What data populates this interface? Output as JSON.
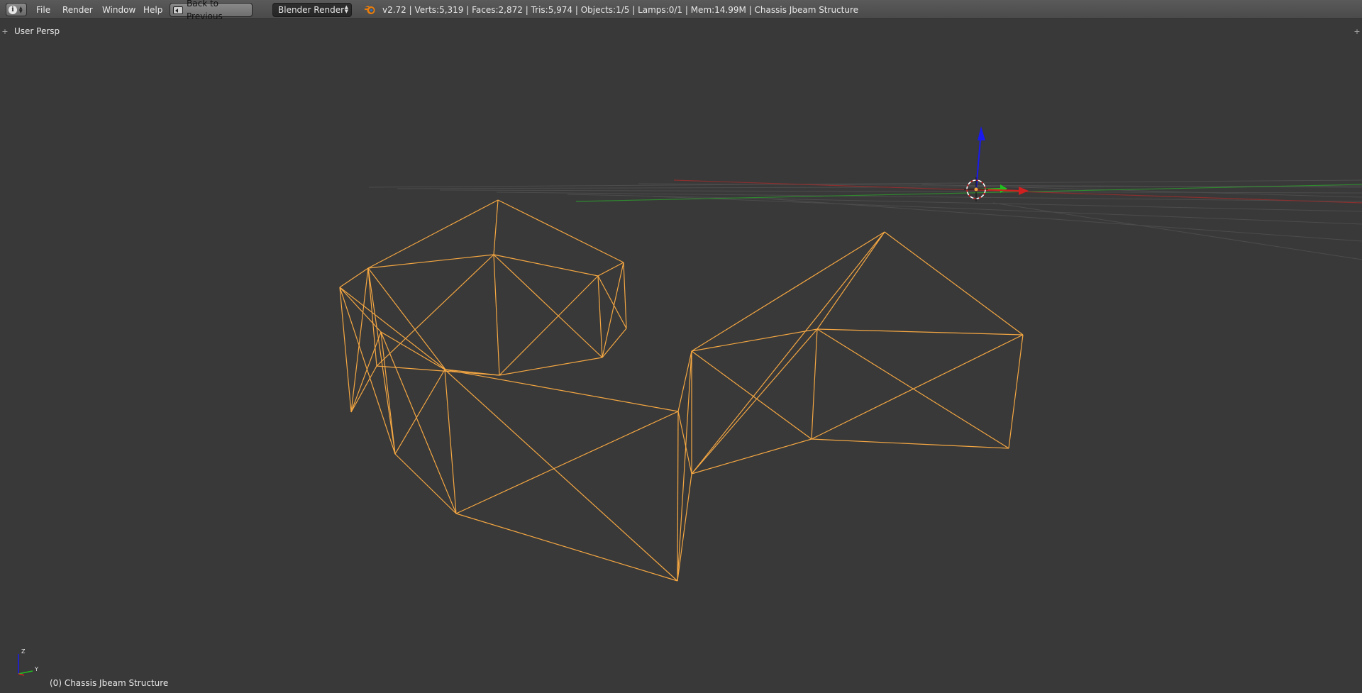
{
  "header": {
    "menus": [
      {
        "label": "File"
      },
      {
        "label": "Render"
      },
      {
        "label": "Window"
      },
      {
        "label": "Help"
      }
    ],
    "back_button_label": "Back to Previous",
    "render_engine": "Blender Render",
    "stats_text": "v2.72 | Verts:5,319 | Faces:2,872 | Tris:5,974 | Objects:1/5 | Lamps:0/1 | Mem:14.99M | Chassis Jbeam Structure"
  },
  "viewport": {
    "view_name": "User Persp",
    "active_object_label": "(0) Chassis Jbeam Structure",
    "axis_labels": {
      "z": "Z",
      "y": "Y"
    }
  },
  "colors": {
    "wire_selected": "#f5a742",
    "axis_x": "#d02020",
    "axis_y": "#20c020",
    "axis_z": "#1a1aee",
    "background": "#393939"
  }
}
